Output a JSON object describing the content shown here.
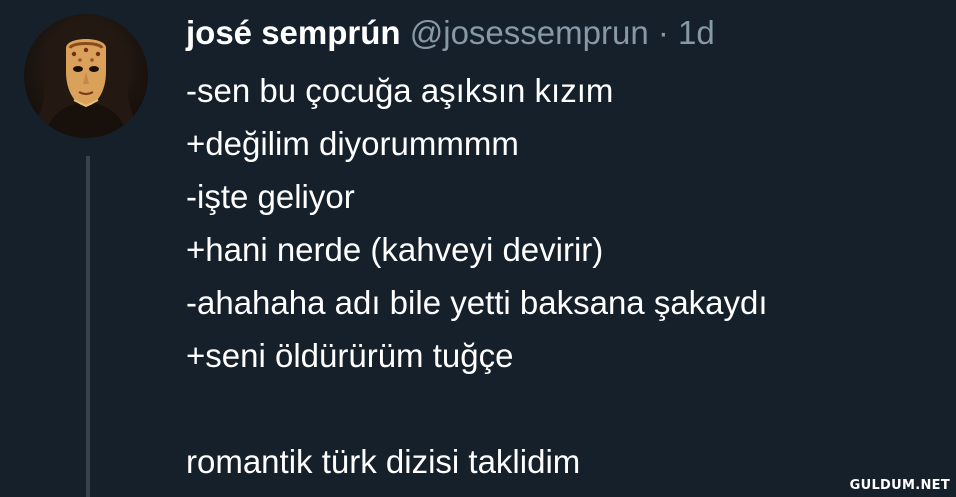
{
  "tweet": {
    "author_name": "josé semprún",
    "handle": "@josessemprun",
    "separator": "·",
    "time": "1d",
    "lines": [
      "-sen bu çocuğa aşıksın kızım",
      "+değilim diyorummmm",
      "-işte geliyor",
      "+hani nerde (kahveyi devirir)",
      "-ahahaha adı bile yetti baksana şakaydı",
      "+seni öldürürüm tuğçe",
      "",
      "romantik türk dizisi taklidim"
    ]
  },
  "watermark": "GULDUM.NET",
  "colors": {
    "background": "#15202b",
    "text": "#ffffff",
    "muted": "#8899a6",
    "thread_line": "#38444d"
  },
  "icons": {
    "avatar": "masked-figure-avatar"
  }
}
